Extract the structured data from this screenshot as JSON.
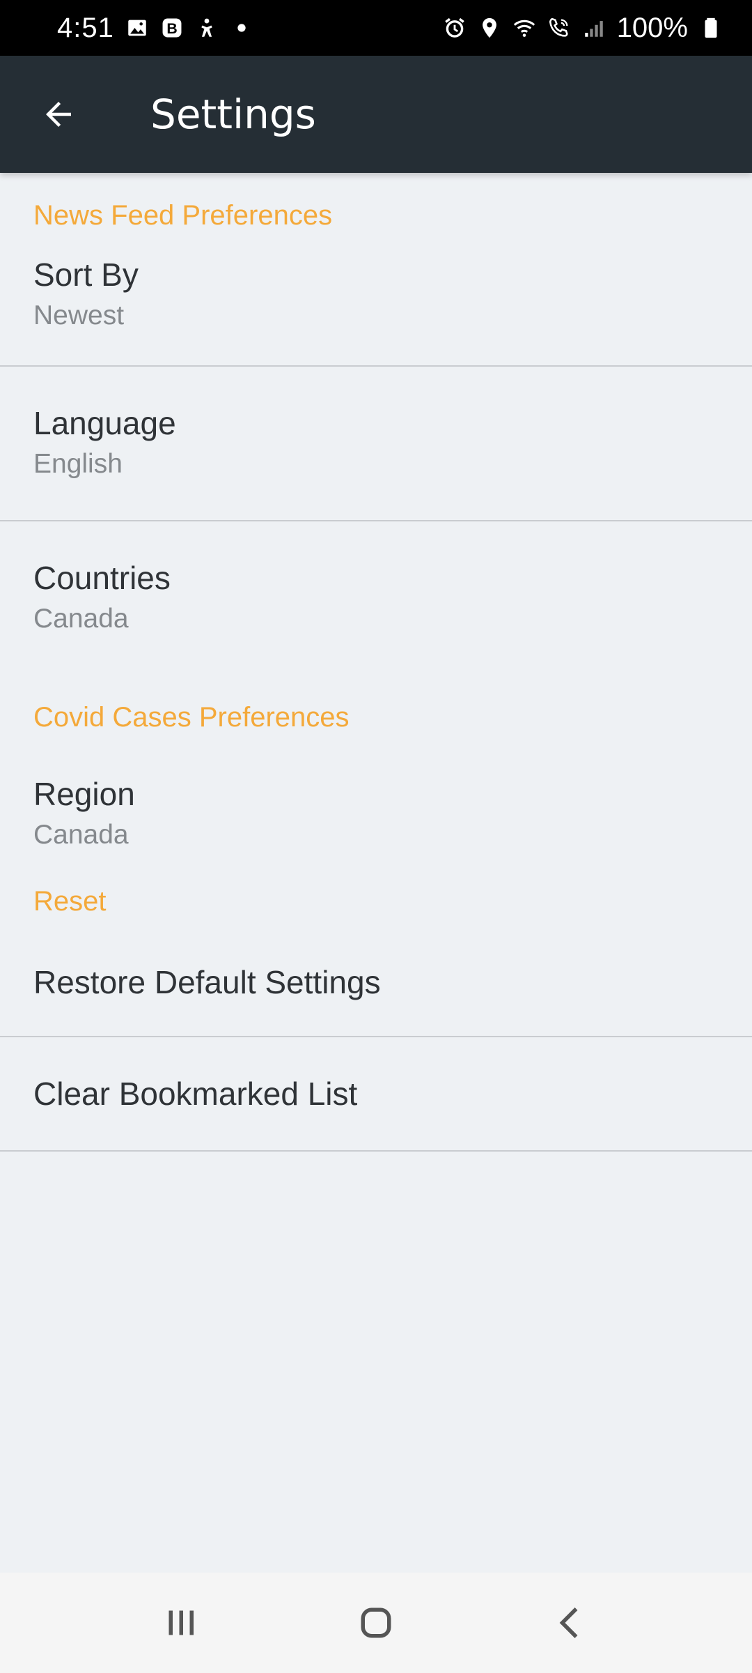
{
  "status_bar": {
    "time": "4:51",
    "battery": "100%",
    "left_icons": [
      "gallery-icon",
      "b-app-icon",
      "accessibility-icon",
      "dot-icon"
    ],
    "right_icons": [
      "alarm-icon",
      "location-icon",
      "wifi-icon",
      "wifi-call-icon",
      "signal-icon",
      "battery-icon"
    ]
  },
  "app_bar": {
    "title": "Settings",
    "back_icon": "arrow-back-icon",
    "background": "#252e35"
  },
  "sections": {
    "news_feed": {
      "header": "News Feed Preferences",
      "items": [
        {
          "title": "Sort By",
          "summary": "Newest"
        },
        {
          "title": "Language",
          "summary": "English"
        },
        {
          "title": "Countries",
          "summary": "Canada"
        }
      ]
    },
    "covid": {
      "header": "Covid Cases Preferences",
      "items": [
        {
          "title": "Region",
          "summary": "Canada"
        }
      ]
    },
    "reset": {
      "header": "Reset",
      "items": [
        {
          "title": "Restore Default Settings"
        },
        {
          "title": "Clear Bookmarked List"
        }
      ]
    }
  },
  "colors": {
    "accent": "#f4a93a",
    "background": "#eef1f4",
    "title_text": "#2f3337",
    "summary_text": "#85898d"
  },
  "nav_bar": {
    "buttons": [
      "recent-apps-icon",
      "home-icon",
      "back-chevron-icon"
    ]
  }
}
